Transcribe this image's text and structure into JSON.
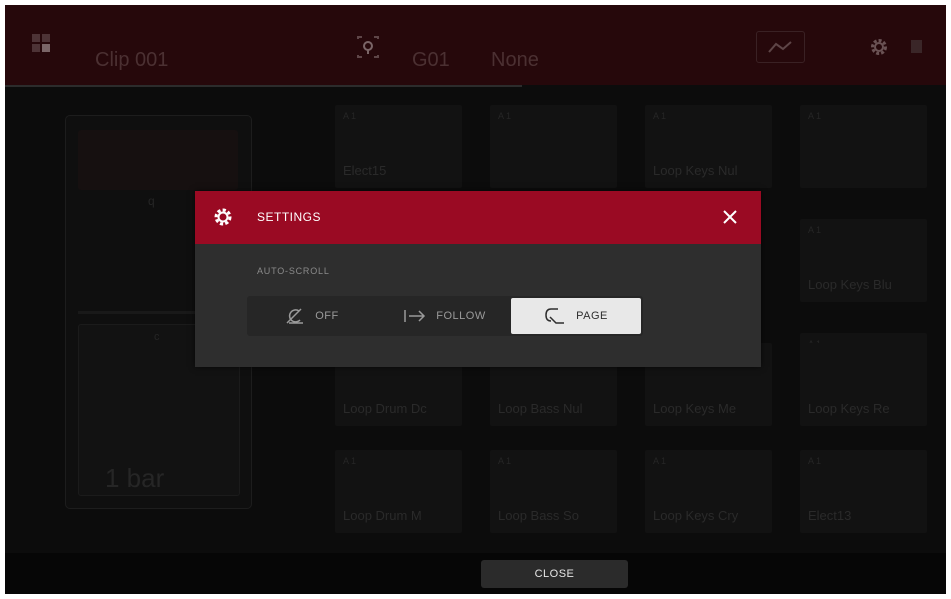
{
  "header": {
    "clip_name": "Clip 001",
    "group_label": "G01",
    "group_value": "None",
    "grid_icon": "pad-grid-icon",
    "locate_icon": "locate-icon",
    "wave_icon": "envelope-icon",
    "gear_icon": "gear-icon",
    "square_icon": "stop-icon"
  },
  "left_panel": {
    "length_label": "1 bar"
  },
  "pads": [
    {
      "tag": "A 1",
      "name": "Elect15"
    },
    {
      "tag": "A 1",
      "name": ""
    },
    {
      "tag": "A 1",
      "name": "Loop Keys Nul"
    },
    {
      "tag": "A 1",
      "name": ""
    },
    {
      "tag": "A 1",
      "name": "Loop Keys Blu"
    },
    {
      "tag": "A 1",
      "name": ""
    },
    {
      "tag": "",
      "name": "Loop Drum Dc"
    },
    {
      "tag": "",
      "name": "Loop Bass Nul"
    },
    {
      "tag": "",
      "name": "Loop Keys Me"
    },
    {
      "tag": "",
      "name": "Loop Keys Re"
    },
    {
      "tag": "A 1",
      "name": "Loop Drum M"
    },
    {
      "tag": "A 1",
      "name": "Loop Bass So"
    },
    {
      "tag": "A 1",
      "name": "Loop Keys Cry"
    },
    {
      "tag": "A 1",
      "name": "Elect13"
    }
  ],
  "modal": {
    "title": "SETTINGS",
    "section_label": "AUTO-SCROLL",
    "options": [
      {
        "label": "OFF",
        "icon": "scroll-off-icon",
        "active": false
      },
      {
        "label": "FOLLOW",
        "icon": "follow-arrow-icon",
        "active": false
      },
      {
        "label": "PAGE",
        "icon": "page-icon",
        "active": true
      }
    ],
    "header_color": "#9a0a23"
  },
  "footer": {
    "close_label": "CLOSE"
  }
}
